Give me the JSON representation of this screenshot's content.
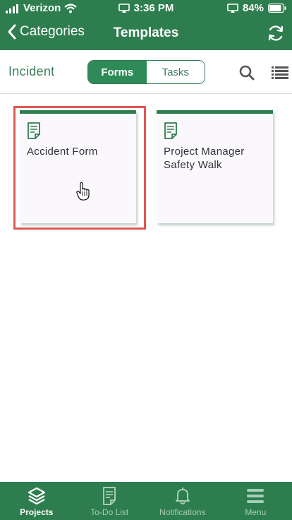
{
  "status_bar": {
    "carrier": "Verizon",
    "time": "3:36 PM",
    "battery": "84%"
  },
  "nav": {
    "back_label": "Categories",
    "title": "Templates"
  },
  "filter": {
    "category": "Incident",
    "segments": [
      {
        "label": "Forms",
        "active": true
      },
      {
        "label": "Tasks",
        "active": false
      }
    ]
  },
  "templates": [
    {
      "title": "Accident Form"
    },
    {
      "title": "Project Manager Safety Walk"
    }
  ],
  "tab_bar": {
    "tabs": [
      {
        "label": "Projects",
        "icon": "layers-icon",
        "active": true
      },
      {
        "label": "To-Do List",
        "icon": "checklist-icon",
        "active": false
      },
      {
        "label": "Notifications",
        "icon": "bell-icon",
        "active": false
      },
      {
        "label": "Menu",
        "icon": "hamburger-icon",
        "active": false
      }
    ]
  },
  "colors": {
    "brand_green": "#2e7d4f",
    "active_green": "#2e8b57",
    "highlight_red": "#e05757",
    "inactive_tab_label": "#a6cdb5"
  }
}
